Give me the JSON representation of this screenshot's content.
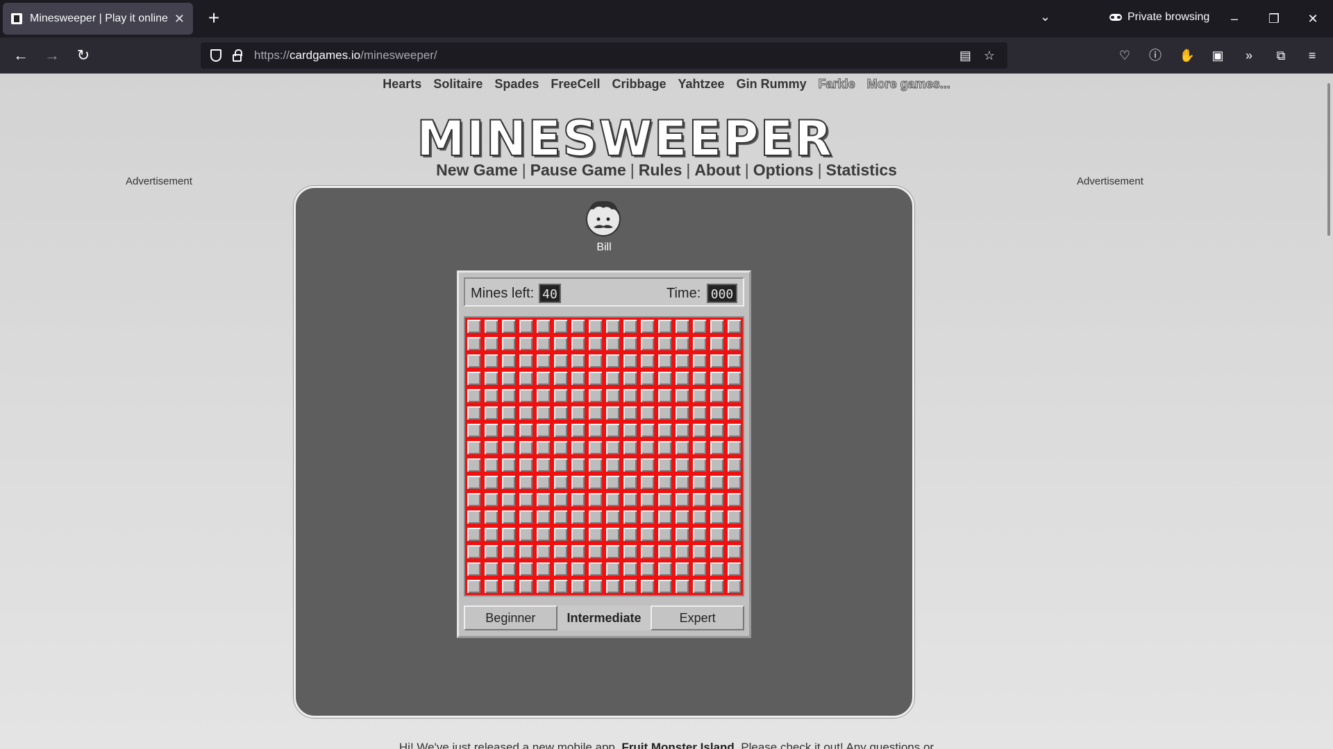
{
  "browser": {
    "tab_title": "Minesweeper | Play it online",
    "tab_close": "✕",
    "new_tab": "+",
    "private_label": "Private browsing",
    "url_prefix": "https://",
    "url_host": "cardgames.io",
    "url_path": "/minesweeper/"
  },
  "site_nav": {
    "items": [
      "Hearts",
      "Solitaire",
      "Spades",
      "FreeCell",
      "Cribbage",
      "Yahtzee",
      "Gin Rummy"
    ],
    "outlined": [
      "Farkle",
      "More games..."
    ]
  },
  "logo_text": "MINESWEEPER",
  "game_menu": [
    "New Game",
    "Pause Game",
    "Rules",
    "About",
    "Options",
    "Statistics"
  ],
  "ads": {
    "left": "Advertisement",
    "right": "Advertisement"
  },
  "player": {
    "name": "Bill"
  },
  "status": {
    "mines_label": "Mines left:",
    "mines_value": "40",
    "time_label": "Time:",
    "time_value": "000"
  },
  "board": {
    "rows": 16,
    "cols": 16
  },
  "levels": [
    {
      "label": "Beginner",
      "active": false
    },
    {
      "label": "Intermediate",
      "active": true
    },
    {
      "label": "Expert",
      "active": false
    }
  ],
  "footer": {
    "prefix": "Hi! We've just released a new mobile app, ",
    "app_name": "Fruit Monster Island",
    "suffix": ". Please check it out! Any questions or"
  },
  "colors": {
    "cell_border": "#e11",
    "panel": "#5e5e5e"
  }
}
